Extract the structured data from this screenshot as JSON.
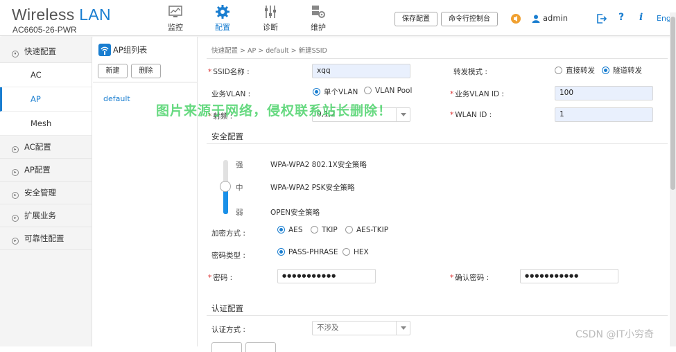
{
  "header": {
    "brand_word1": "Wireless",
    "brand_word2": "LAN",
    "model": "AC6605-26-PWR",
    "nav": [
      {
        "label": "监控",
        "icon": "monitor-icon"
      },
      {
        "label": "配置",
        "icon": "gear-icon"
      },
      {
        "label": "诊断",
        "icon": "sliders-icon"
      },
      {
        "label": "维护",
        "icon": "maintenance-icon"
      }
    ],
    "save_config": "保存配置",
    "cli_console": "命令行控制台",
    "user": "admin",
    "lang": "Eng",
    "accent": "#1a7ed0"
  },
  "sidebar": {
    "quick_config": "快速配置",
    "sub_items": [
      "AC",
      "AP",
      "Mesh"
    ],
    "active_sub": "AP",
    "items": [
      "AC配置",
      "AP配置",
      "安全管理",
      "扩展业务",
      "可靠性配置"
    ]
  },
  "ap_group": {
    "title": "AP组列表",
    "new_button": "新建",
    "delete_button": "删除",
    "groups": [
      "default"
    ]
  },
  "form": {
    "breadcrumb": "快速配置 > AP > default > 新建SSID",
    "ssid_label": "SSID名称 :",
    "ssid_value": "xqq",
    "forward_label": "转发模式 :",
    "forward_direct": "直接转发",
    "forward_tunnel": "隧道转发",
    "vlan_label": "业务VLAN :",
    "vlan_single": "单个VLAN",
    "vlan_pool": "VLAN Pool",
    "vlan_id_label": "业务VLAN ID :",
    "vlan_id_value": "100",
    "radio_label": "射频 :",
    "radio_value": "0,1,2",
    "wlan_id_label": "WLAN ID :",
    "wlan_id_value": "1",
    "security_title": "安全配置",
    "level_strong": "强",
    "level_mid": "中",
    "level_weak": "弱",
    "policy_strong": "WPA-WPA2 802.1X安全策略",
    "policy_mid": "WPA-WPA2 PSK安全策略",
    "policy_weak": "OPEN安全策略",
    "encrypt_label": "加密方式 :",
    "encrypt_aes": "AES",
    "encrypt_tkip": "TKIP",
    "encrypt_aes_tkip": "AES-TKIP",
    "pwd_type_label": "密码类型 :",
    "pwd_passphrase": "PASS-PHRASE",
    "pwd_hex": "HEX",
    "pwd_label": "密码 :",
    "pwd_value": "●●●●●●●●●●●",
    "confirm_pwd_label": "确认密码 :",
    "confirm_pwd_value": "●●●●●●●●●●●",
    "auth_title": "认证配置",
    "auth_label": "认证方式 :",
    "auth_value": "不涉及"
  },
  "watermark": "图片来源于网络，侵权联系站长删除！",
  "credit": "CSDN @IT小穷奇"
}
